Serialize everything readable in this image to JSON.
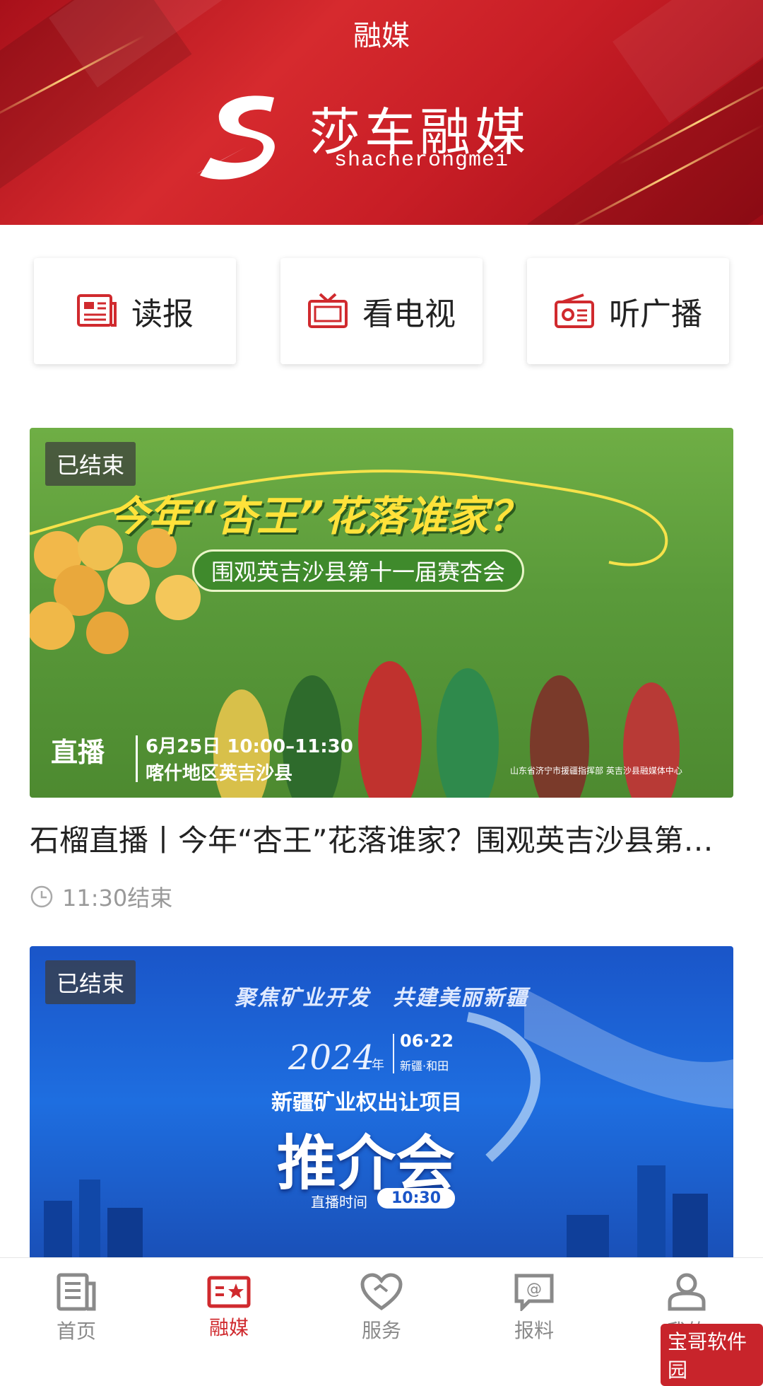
{
  "header": {
    "title": "融媒",
    "brand_name": "莎车融媒",
    "brand_sub": "shacherongmei"
  },
  "quick_actions": [
    {
      "label": "读报",
      "icon": "newspaper-icon"
    },
    {
      "label": "看电视",
      "icon": "tv-icon"
    },
    {
      "label": "听广播",
      "icon": "radio-icon"
    }
  ],
  "colors": {
    "accent": "#d02a2e",
    "header_red": "#c81e26",
    "banner1_green": "#5a9a3a",
    "banner2_blue": "#1a55c8"
  },
  "cards": [
    {
      "badge": "已结束",
      "banner": {
        "headline": "今年“杏王”花落谁家？",
        "subheadline": "围观英吉沙县第十一届赛杏会",
        "live_label": "直播",
        "date_time": "6月25日 10:00–11:30",
        "location": "喀什地区英吉沙县",
        "sponsors": "山东省济宁市援疆指挥部  英吉沙县融媒体中心"
      },
      "title": "石榴直播丨今年“杏王”花落谁家？围观英吉沙县第十一届赛杏会",
      "meta": "11:30结束"
    },
    {
      "badge": "已结束",
      "banner": {
        "slogan": "聚焦矿业开发　共建美丽新疆",
        "year": "2024",
        "year_unit": "年",
        "date": "06·22",
        "place": "新疆·和田",
        "subtitle": "新疆矿业权出让项目",
        "headline": "推介会",
        "live_time_label": "直播时间",
        "live_time": "10:30"
      }
    }
  ],
  "tabbar": [
    {
      "label": "首页",
      "icon": "home-news-icon",
      "active": false
    },
    {
      "label": "融媒",
      "icon": "media-star-icon",
      "active": true
    },
    {
      "label": "服务",
      "icon": "heart-service-icon",
      "active": false
    },
    {
      "label": "报料",
      "icon": "report-chat-icon",
      "active": false
    },
    {
      "label": "我的",
      "icon": "user-icon",
      "active": false
    }
  ],
  "watermark": "宝哥软件园"
}
